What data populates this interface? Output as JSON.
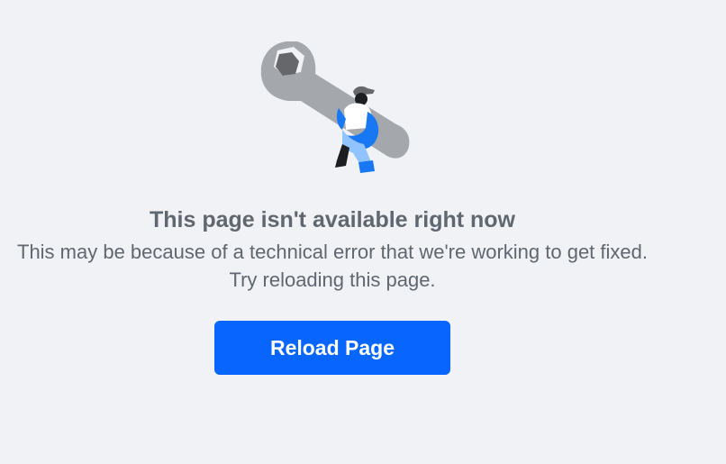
{
  "illustration": {
    "icon": "wrench-worker-illustration",
    "colors": {
      "wrench": "#a4a7ab",
      "hex_nut": "#65676b",
      "figure_blue": "#1877f2",
      "figure_light_blue": "#90c3ff",
      "figure_dark": "#1c1e21"
    }
  },
  "error": {
    "title": "This page isn't available right now",
    "message": "This may be because of a technical error that we're working to get fixed. Try reloading this page."
  },
  "actions": {
    "reload_label": "Reload Page",
    "button_color": "#0866ff"
  }
}
